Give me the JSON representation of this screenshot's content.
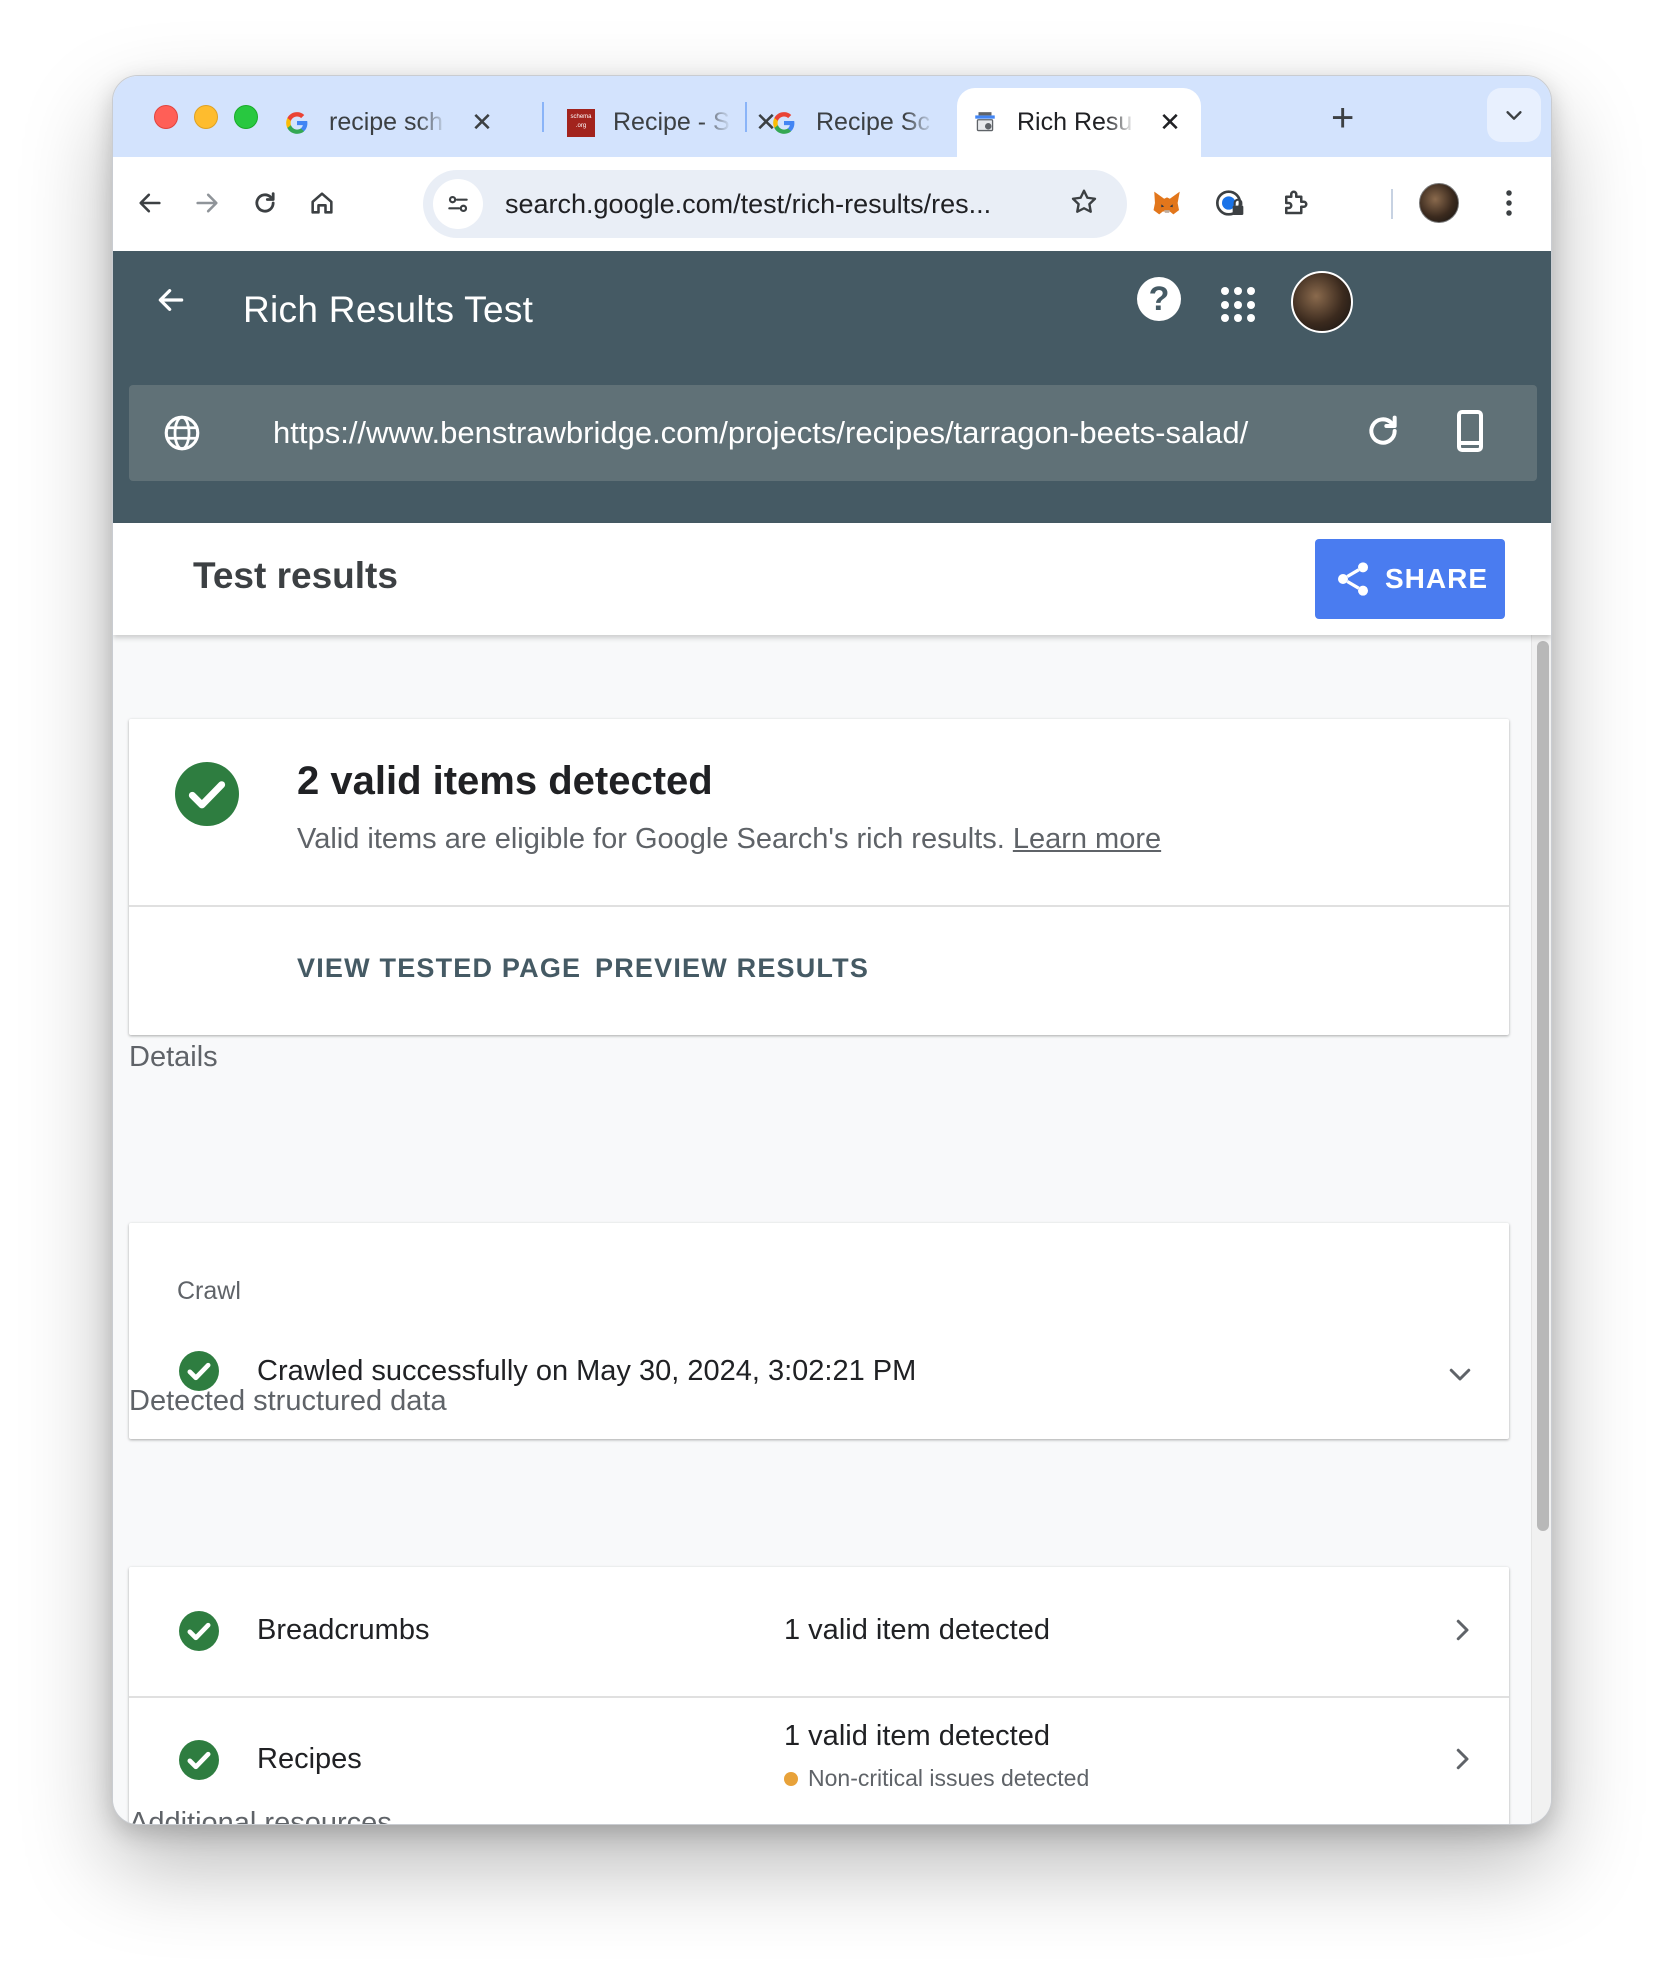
{
  "browser": {
    "tabs": [
      {
        "title": "recipe sch",
        "favicon": "google-g-icon"
      },
      {
        "title": "Recipe - S",
        "favicon": "schema-org-icon"
      },
      {
        "title": "Recipe Sc",
        "favicon": "google-g-icon"
      },
      {
        "title": "Rich Resu",
        "favicon": "rich-results-icon",
        "active": true
      }
    ],
    "schema_favicon_text": "schema .org",
    "address": "search.google.com/test/rich-results/res..."
  },
  "app": {
    "title": "Rich Results Test",
    "tested_url": "https://www.benstrawbridge.com/projects/recipes/tarragon-beets-salad/"
  },
  "results": {
    "heading": "Test results",
    "share_label": "SHARE",
    "summary": {
      "headline": "2 valid items detected",
      "subtext": "Valid items are eligible for Google Search's rich results.",
      "learn_more": "Learn more",
      "actions": [
        "VIEW TESTED PAGE",
        "PREVIEW RESULTS"
      ]
    },
    "details_label": "Details",
    "crawl": {
      "caption": "Crawl",
      "status": "Crawled successfully on May 30, 2024, 3:02:21 PM"
    },
    "structured_label": "Detected structured data",
    "items": [
      {
        "name": "Breadcrumbs",
        "status": "1 valid item detected",
        "warning": ""
      },
      {
        "name": "Recipes",
        "status": "1 valid item detected",
        "warning": "Non-critical issues detected"
      }
    ],
    "additional_label": "Additional resources"
  },
  "colors": {
    "header_bg": "#455a64",
    "share_bg": "#4a7cf0",
    "valid_green": "#2e7d40",
    "warning_orange": "#e8a23a"
  }
}
